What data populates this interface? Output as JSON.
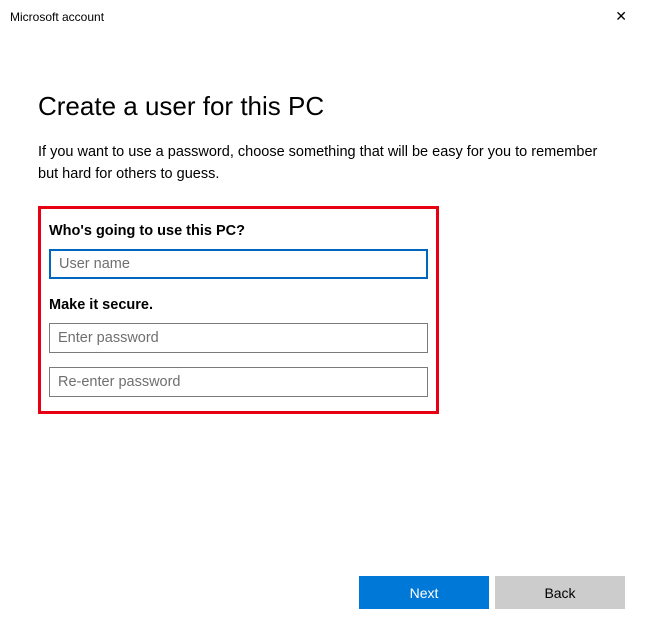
{
  "titlebar": {
    "title": "Microsoft account",
    "close_glyph": "✕"
  },
  "heading": "Create a user for this PC",
  "subtitle": "If you want to use a password, choose something that will be easy for you to remember but hard for others to guess.",
  "form": {
    "section1_label": "Who's going to use this PC?",
    "username_placeholder": "User name",
    "username_value": "",
    "section2_label": "Make it secure.",
    "password_placeholder": "Enter password",
    "password_value": "",
    "confirm_placeholder": "Re-enter password",
    "confirm_value": ""
  },
  "footer": {
    "next_label": "Next",
    "back_label": "Back"
  }
}
